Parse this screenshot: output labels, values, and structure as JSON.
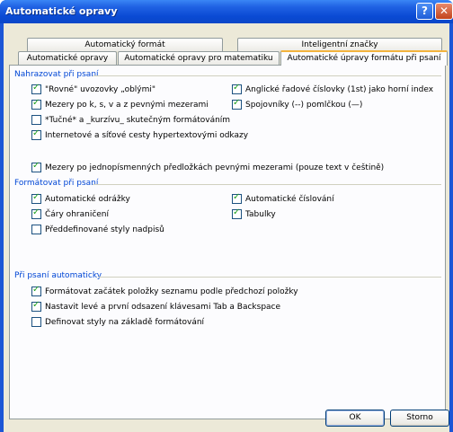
{
  "window": {
    "title": "Automatické opravy",
    "help_glyph": "?",
    "close_glyph": "✕"
  },
  "tabs": {
    "row_top": [
      "Automatický formát",
      "Inteligentní značky"
    ],
    "row_bottom": [
      "Automatické opravy",
      "Automatické opravy pro matematiku",
      "Automatické úpravy formátu při psaní"
    ],
    "active": "Automatické úpravy formátu při psaní"
  },
  "sections": {
    "replace": {
      "title": "Nahrazovat při psaní",
      "items": [
        {
          "label": "\"Rovné\" uvozovky „oblými\"",
          "checked": true
        },
        {
          "label": "Anglické řadové číslovky (1st) jako horní index",
          "checked": true
        },
        {
          "label": "Mezery po k, s, v a z pevnými mezerami",
          "checked": true
        },
        {
          "label": "Spojovníky (--) pomlčkou (—)",
          "checked": true
        },
        {
          "label": "*Tučné* a _kurzívu_ skutečným formátováním",
          "checked": false
        },
        {
          "label": "Internetové a síťové cesty hypertextovými odkazy",
          "checked": true
        },
        {
          "label": "Mezery po jednopísmenných předložkách pevnými mezerami (pouze text v češtině)",
          "checked": true
        }
      ]
    },
    "format": {
      "title": "Formátovat při psaní",
      "items": [
        {
          "label": "Automatické odrážky",
          "checked": true
        },
        {
          "label": "Automatické číslování",
          "checked": true
        },
        {
          "label": "Čáry ohraničení",
          "checked": true
        },
        {
          "label": "Tabulky",
          "checked": true
        },
        {
          "label": "Předdefinované styly nadpisů",
          "checked": false
        }
      ]
    },
    "auto": {
      "title": "Při psaní automaticky",
      "items": [
        {
          "label": "Formátovat začátek položky seznamu podle předchozí položky",
          "checked": true
        },
        {
          "label": "Nastavit levé a první odsazení klávesami Tab a Backspace",
          "checked": true
        },
        {
          "label": "Definovat styly na základě formátování",
          "checked": false
        }
      ]
    }
  },
  "buttons": {
    "ok": "OK",
    "cancel": "Storno"
  },
  "colors": {
    "section_title": "#0046d5",
    "check": "#21a121",
    "titlebar": "#0a4ad4"
  }
}
